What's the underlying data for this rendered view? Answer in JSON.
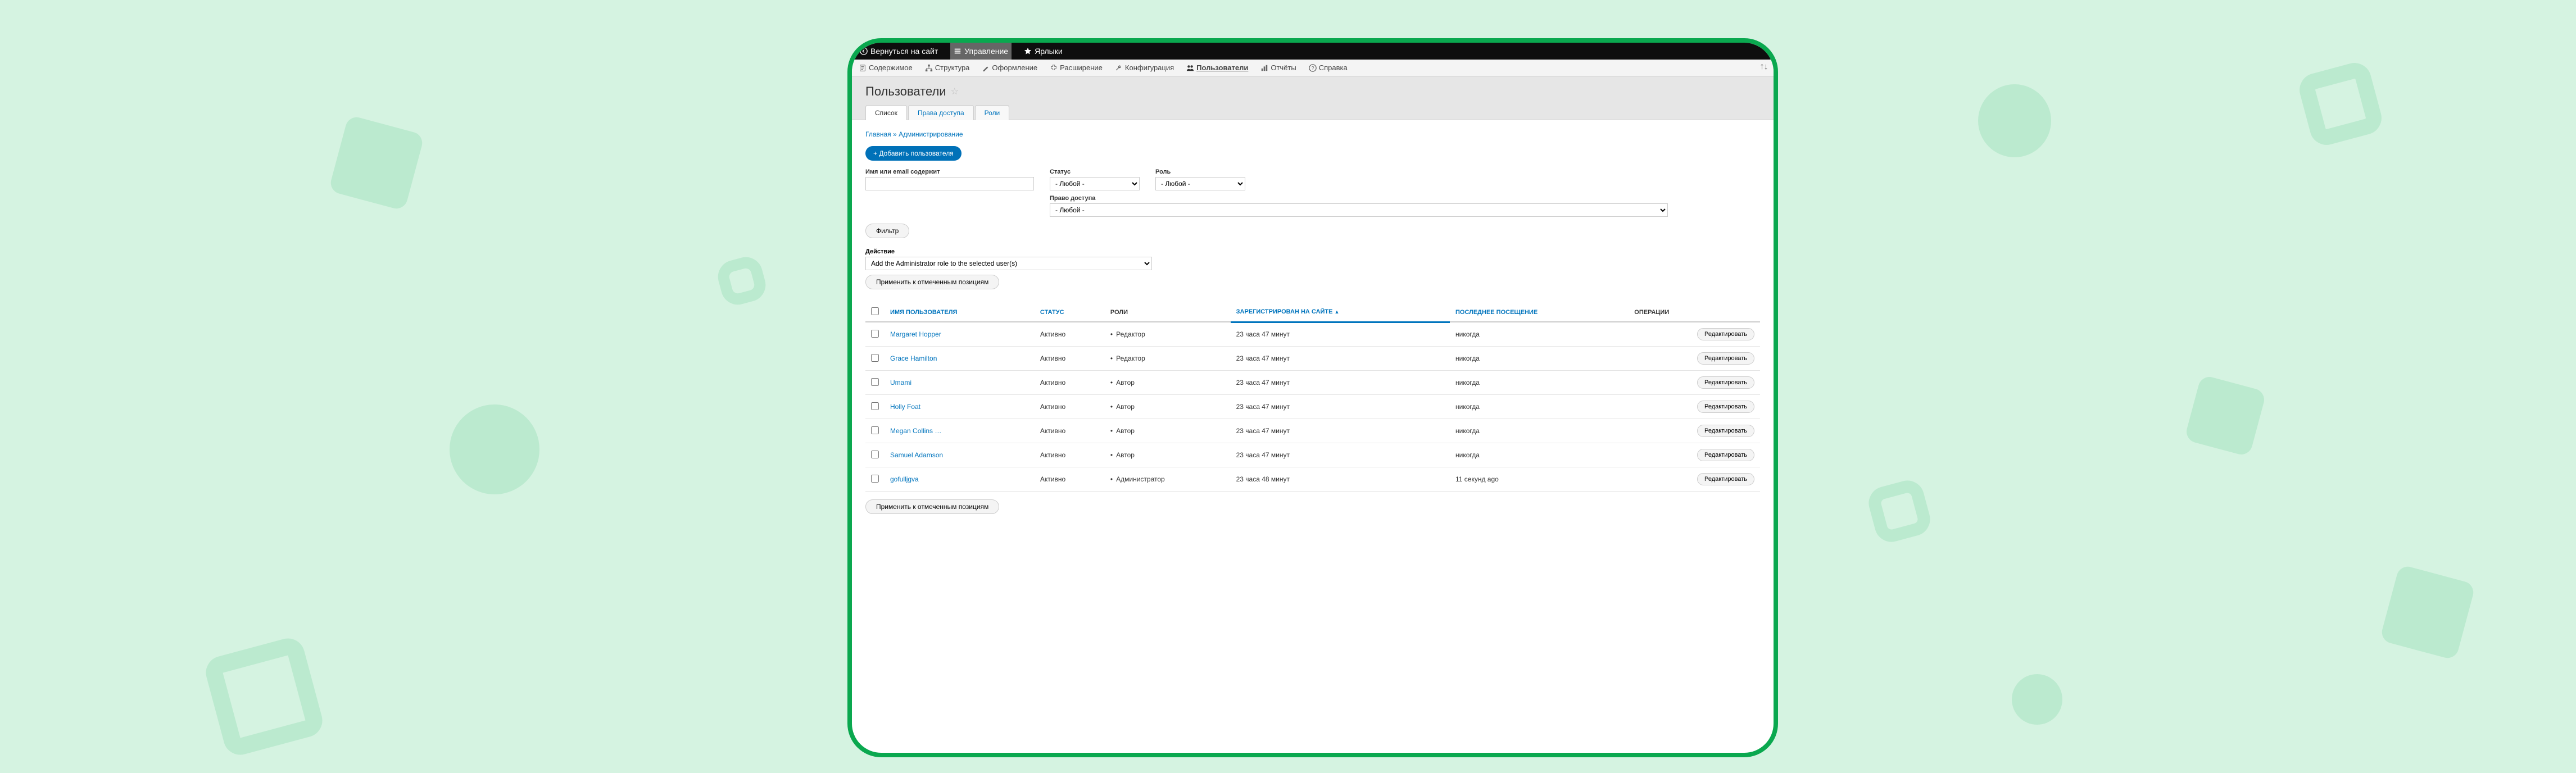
{
  "toolbar_top": {
    "back": "Вернуться на сайт",
    "manage": "Управление",
    "shortcuts": "Ярлыки"
  },
  "toolbar_menu": {
    "content": "Содержимое",
    "structure": "Структура",
    "appearance": "Оформление",
    "extend": "Расширение",
    "config": "Конфигурация",
    "people": "Пользователи",
    "reports": "Отчёты",
    "help": "Справка"
  },
  "page": {
    "title": "Пользователи"
  },
  "tabs": {
    "list": "Список",
    "permissions": "Права доступа",
    "roles": "Роли"
  },
  "breadcrumb": {
    "home": "Главная",
    "sep": "»",
    "admin": "Администрирование"
  },
  "buttons": {
    "add_user": "+ Добавить пользователя",
    "filter": "Фильтр",
    "apply": "Применить к отмеченным позициям",
    "edit": "Редактировать"
  },
  "filters": {
    "name_label": "Имя или email содержит",
    "status_label": "Статус",
    "status_value": "- Любой -",
    "role_label": "Роль",
    "role_value": "- Любой -",
    "permission_label": "Право доступа",
    "permission_value": "- Любой -"
  },
  "action": {
    "label": "Действие",
    "value": "Add the Administrator role to the selected user(s)"
  },
  "columns": {
    "username": "ИМЯ ПОЛЬЗОВАТЕЛЯ",
    "status": "СТАТУС",
    "roles": "РОЛИ",
    "member": "ЗАРЕГИСТРИРОВАН НА САЙТЕ",
    "access": "ПОСЛЕДНЕЕ ПОСЕЩЕНИЕ",
    "ops": "ОПЕРАЦИИ"
  },
  "rows": [
    {
      "name": "Margaret Hopper",
      "status": "Активно",
      "role": "Редактор",
      "member": "23 часа 47 минут",
      "access": "никогда"
    },
    {
      "name": "Grace Hamilton",
      "status": "Активно",
      "role": "Редактор",
      "member": "23 часа 47 минут",
      "access": "никогда"
    },
    {
      "name": "Umami",
      "status": "Активно",
      "role": "Автор",
      "member": "23 часа 47 минут",
      "access": "никогда"
    },
    {
      "name": "Holly Foat",
      "status": "Активно",
      "role": "Автор",
      "member": "23 часа 47 минут",
      "access": "никогда"
    },
    {
      "name": "Megan Collins …",
      "status": "Активно",
      "role": "Автор",
      "member": "23 часа 47 минут",
      "access": "никогда"
    },
    {
      "name": "Samuel Adamson",
      "status": "Активно",
      "role": "Автор",
      "member": "23 часа 47 минут",
      "access": "никогда"
    },
    {
      "name": "gofulljgva",
      "status": "Активно",
      "role": "Администратор",
      "member": "23 часа 48 минут",
      "access": "11 секунд ago"
    }
  ]
}
